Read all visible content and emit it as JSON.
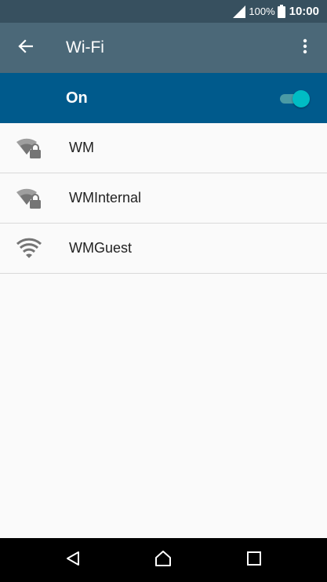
{
  "status_bar": {
    "battery_percent": "100%",
    "time": "10:00",
    "icons": [
      "signal-icon",
      "battery-icon"
    ]
  },
  "app_bar": {
    "title": "Wi-Fi",
    "icons": [
      "back-arrow-icon",
      "more-vert-icon"
    ]
  },
  "wifi_switch": {
    "label": "On",
    "enabled": true
  },
  "networks": [
    {
      "name": "WM",
      "secured": true,
      "icon": "wifi-lock-icon"
    },
    {
      "name": "WMInternal",
      "secured": true,
      "icon": "wifi-lock-icon"
    },
    {
      "name": "WMGuest",
      "secured": false,
      "icon": "wifi-icon"
    }
  ],
  "nav_bar": {
    "icons": [
      "nav-back-icon",
      "nav-home-icon",
      "nav-recents-icon"
    ]
  },
  "colors": {
    "status_bar": "#37505f",
    "app_bar": "#4b6878",
    "switch_bar": "#005a8c",
    "toggle_thumb": "#00bcc4",
    "icon_gray": "#757575"
  }
}
